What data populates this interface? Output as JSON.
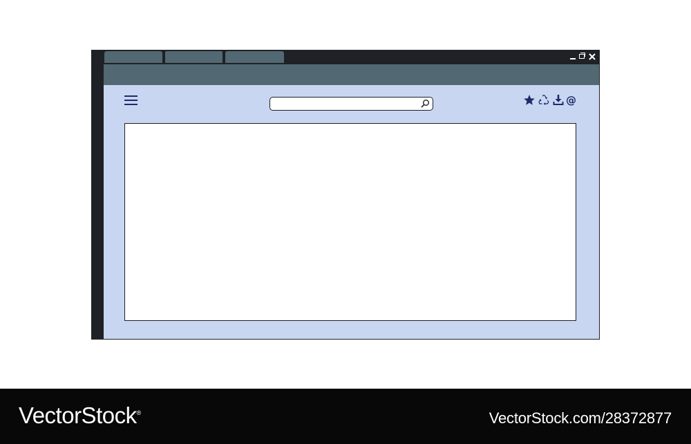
{
  "window": {
    "tabs": [
      "",
      "",
      ""
    ],
    "active_tab_index": 1,
    "controls": [
      "minimize-icon",
      "restore-icon",
      "close-icon"
    ]
  },
  "toolbar": {
    "menu_icon": "hamburger-menu-icon",
    "search": {
      "value": "",
      "placeholder": "",
      "icon": "search-icon"
    },
    "actions": [
      "star-icon",
      "recycle-icon",
      "download-icon",
      "at-sign-icon"
    ],
    "at_symbol": "@"
  },
  "footer": {
    "brand": "VectorStock",
    "registered": "®",
    "reference": "VectorStock.com/28372877"
  },
  "colors": {
    "frame": "#1e2126",
    "tab": "#526873",
    "toolbar": "#526873",
    "body": "#c9d6f1",
    "icon": "#1d2a6b",
    "content": "#ffffff",
    "footer": "#080808"
  }
}
